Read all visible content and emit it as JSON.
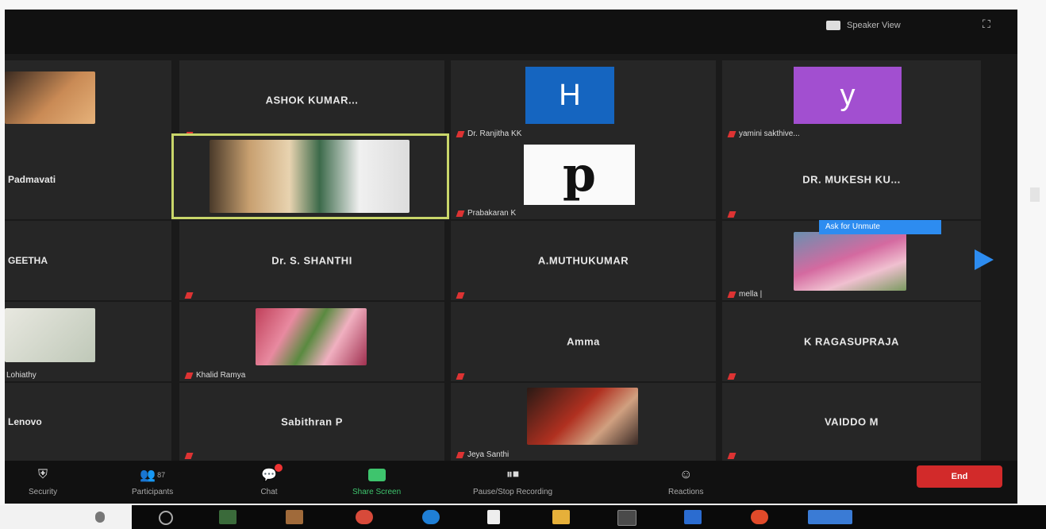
{
  "topbar": {
    "view_label": "Speaker View",
    "fullscreen_icon": "fullscreen-icon"
  },
  "tiles": {
    "r1c1_caption": "",
    "r1c2_name": "ASHOK KUMAR...",
    "r1c3_avatar": "H",
    "r1c3_caption": "Dr. Ranjitha KK",
    "r1c4_avatar": "y",
    "r1c4_caption": "yamini sakthive...",
    "r2c1_name": "Padmavati",
    "r2c2_caption": "",
    "r2c3_caption": "Prabakaran K",
    "r2c4_name": "DR. MUKESH KU...",
    "r3c1_name": "GEETHA",
    "r3c2_name": "Dr. S. SHANTHI",
    "r3c3_name": "A.MUTHUKUMAR",
    "r3c4_caption": "mella |",
    "r3c4_hint": "Ask for Unmute",
    "r4c1_caption": "Lohiathy",
    "r4c2_caption": "Khalid Ramya",
    "r4c3_name": "Amma",
    "r4c4_name": "K RAGASUPRAJA",
    "r5c1_name": "Lenovo",
    "r5c2_name": "Sabithran P",
    "r5c3_caption": "Jeya Santhi",
    "r5c4_name": "VAIDDO M"
  },
  "toolbar": {
    "security": "Security",
    "participants": "Participants",
    "participants_count": "87",
    "chat": "Chat",
    "share": "Share Screen",
    "record": "Pause/Stop Recording",
    "reactions": "Reactions",
    "end": "End"
  },
  "colors": {
    "accent_blue": "#2d8cf0",
    "end_red": "#d22a2a",
    "active_speaker": "#c9d66a",
    "avatar_h": "#1565c0",
    "avatar_y": "#a24fd0"
  }
}
